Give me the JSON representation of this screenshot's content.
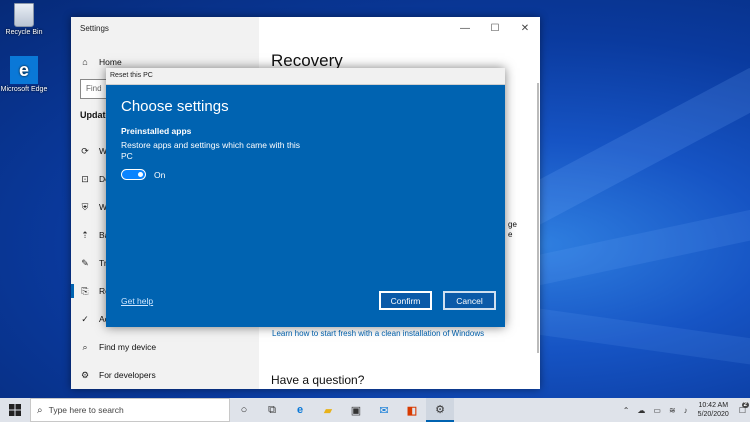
{
  "desktop": {
    "icons": [
      {
        "label": "Recycle Bin"
      },
      {
        "label": "Microsoft Edge",
        "glyph": "e"
      }
    ]
  },
  "settings": {
    "title": "Settings",
    "controls": {
      "minimize": "—",
      "maximize": "☐",
      "close": "✕"
    },
    "home_label": "Home",
    "find_placeholder": "Find",
    "section_label": "Update",
    "nav_items": [
      {
        "label": "W",
        "icon": "sync-icon"
      },
      {
        "label": "De",
        "icon": "delivery-icon"
      },
      {
        "label": "W",
        "icon": "shield-icon"
      },
      {
        "label": "Ba",
        "icon": "backup-icon"
      },
      {
        "label": "Tr",
        "icon": "wrench-icon"
      },
      {
        "label": "Re",
        "icon": "recovery-icon"
      },
      {
        "label": "Ac",
        "icon": "activation-icon"
      },
      {
        "label": "Find my device",
        "icon": "find-device-icon"
      },
      {
        "label": "For developers",
        "icon": "developers-icon"
      }
    ],
    "content_title": "Recovery",
    "content_fragments": [
      "ge",
      "e"
    ],
    "link": "Learn how to start fresh with a clean installation of Windows",
    "question": "Have a question?"
  },
  "dialog": {
    "title": "Reset this PC",
    "heading": "Choose settings",
    "subheading": "Preinstalled apps",
    "description": "Restore apps and settings which came with this PC",
    "toggle_label": "On",
    "help_link": "Get help",
    "confirm_label": "Confirm",
    "cancel_label": "Cancel"
  },
  "taskbar": {
    "search_placeholder": "Type here to search",
    "clock_time": "10:42 AM",
    "clock_date": "5/20/2020",
    "notification_count": "2"
  }
}
